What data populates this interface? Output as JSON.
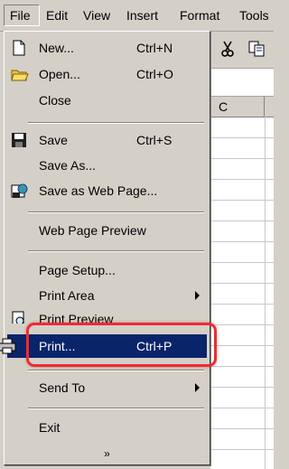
{
  "menubar": {
    "items": [
      "File",
      "Edit",
      "View",
      "Insert",
      "Format",
      "Tools"
    ],
    "active": "File"
  },
  "toolbar": {
    "icons": [
      "scissors-icon",
      "copy-icon"
    ]
  },
  "sheet": {
    "column_header": "C"
  },
  "file_menu": {
    "items": [
      {
        "label": "New...",
        "shortcut": "Ctrl+N",
        "icon": "new-document-icon"
      },
      {
        "label": "Open...",
        "shortcut": "Ctrl+O",
        "icon": "open-folder-icon"
      },
      {
        "label": "Close",
        "shortcut": ""
      },
      {
        "label": "Save",
        "shortcut": "Ctrl+S",
        "icon": "floppy-disk-icon"
      },
      {
        "label": "Save As...",
        "shortcut": ""
      },
      {
        "label": "Save as Web Page...",
        "shortcut": "",
        "icon": "web-page-icon"
      },
      {
        "label": "Web Page Preview",
        "shortcut": ""
      },
      {
        "label": "Page Setup...",
        "shortcut": ""
      },
      {
        "label": "Print Area",
        "shortcut": "",
        "submenu": true
      },
      {
        "label": "Print Preview",
        "shortcut": "",
        "icon": "print-preview-icon"
      },
      {
        "label": "Print...",
        "shortcut": "Ctrl+P",
        "icon": "printer-icon",
        "highlighted": true
      },
      {
        "label": "Send To",
        "shortcut": "",
        "submenu": true
      },
      {
        "label": "Exit",
        "shortcut": ""
      }
    ],
    "expand_glyph": "»"
  },
  "colors": {
    "menu_bg": "#d4d0c8",
    "highlight": "#0a246a",
    "callout": "#ee2b35"
  }
}
